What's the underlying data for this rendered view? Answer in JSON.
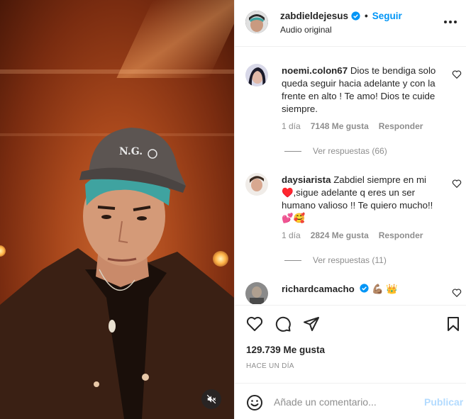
{
  "post": {
    "username": "zabdieldejesus",
    "separator": "•",
    "follow_label": "Seguir",
    "audio_label": "Audio original",
    "verified": true
  },
  "comments": [
    {
      "username": "noemi.colon67",
      "text": "Dios te bendiga solo queda seguir hacia adelante y con la frente en alto ! Te amo! Dios te cuide siempre.",
      "age": "1 día",
      "likes": "7148 Me gusta",
      "reply_label": "Responder",
      "view_replies": "Ver respuestas (66)"
    },
    {
      "username": "daysiarista",
      "text": "Zabdiel siempre en mi ♥️,sigue adelante q eres un ser humano valioso !! Te quiero mucho!! 💕🥰",
      "age": "1 día",
      "likes": "2824 Me gusta",
      "reply_label": "Responder",
      "view_replies": "Ver respuestas (11)"
    },
    {
      "username": "richardcamacho",
      "text": "💪🏽 👑",
      "verified": true
    }
  ],
  "stats": {
    "likes": "129.739 Me gusta",
    "time": "HACE UN DÍA"
  },
  "composer": {
    "placeholder": "Añade un comentario...",
    "publish_label": "Publicar"
  },
  "colors": {
    "accent": "#0095f6",
    "publish_disabled": "#b3dbff",
    "muted_text": "#8e8e8e"
  },
  "icons": [
    "verified-badge-icon",
    "more-options-icon",
    "heart-icon",
    "comment-icon",
    "share-icon",
    "bookmark-icon",
    "emoji-icon",
    "mute-icon"
  ]
}
